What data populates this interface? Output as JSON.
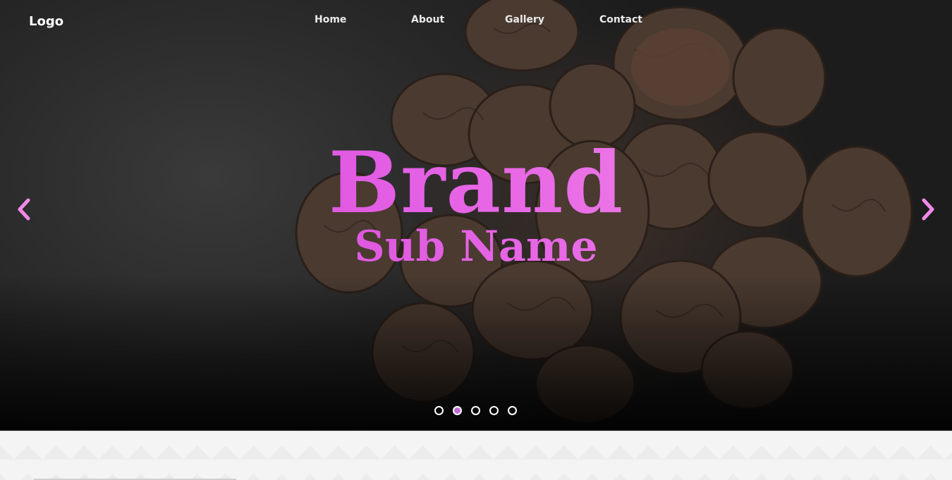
{
  "header": {
    "logo": "Logo",
    "nav": [
      {
        "label": "Home"
      },
      {
        "label": "About"
      },
      {
        "label": "Gallery"
      },
      {
        "label": "Contact"
      }
    ]
  },
  "hero": {
    "title": "Brand",
    "subtitle": "Sub Name",
    "prev_icon": "chevron-left-icon",
    "next_icon": "chevron-right-icon",
    "slides_total": 5,
    "active_slide": 2,
    "accent_color": "#e060e0"
  }
}
